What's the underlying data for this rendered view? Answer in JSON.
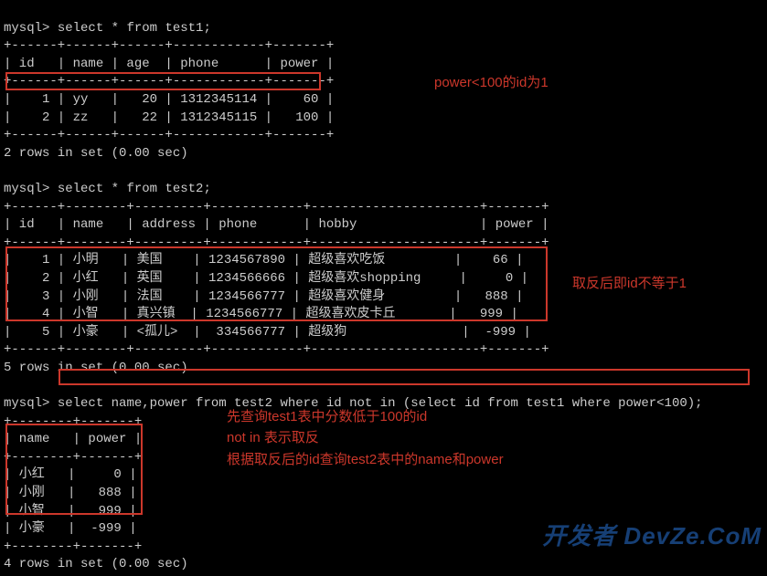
{
  "prompt": "mysql>",
  "query1": "select * from test1;",
  "table1": {
    "border_top": "+------+------+------+------------+-------+",
    "header": "| id   | name | age  | phone      | power |",
    "border_mid": "+------+------+------+------------+-------+",
    "row1": "|    1 | yy   |   20 | 1312345114 |    60 |",
    "row2": "|    2 | zz   |   22 | 1312345115 |   100 |",
    "border_bot": "+------+------+------+------------+-------+",
    "summary": "2 rows in set (0.00 sec)"
  },
  "query2": "select * from test2;",
  "table2": {
    "border_top": "+------+--------+---------+------------+----------------------+-------+",
    "header": "| id   | name   | address | phone      | hobby                | power |",
    "border_mid": "+------+--------+---------+------------+----------------------+-------+",
    "row1": "|    1 | 小明   | 美国    | 1234567890 | 超级喜欢吃饭         |    66 |",
    "row2": "|    2 | 小红   | 英国    | 1234566666 | 超级喜欢shopping     |     0 |",
    "row3": "|    3 | 小刚   | 法国    | 1234566777 | 超级喜欢健身         |   888 |",
    "row4": "|    4 | 小智   | 真兴镇  | 1234566777 | 超级喜欢皮卡丘       |   999 |",
    "row5": "|    5 | 小豪   | <孤儿>  |  334566777 | 超级狗               |  -999 |",
    "border_bot": "+------+--------+---------+------------+----------------------+-------+",
    "summary": "5 rows in set (0.00 sec)"
  },
  "query3": "select name,power from test2 where id not in (select id from test1 where power<100);",
  "table3": {
    "border_top": "+--------+-------+",
    "header": "| name   | power |",
    "border_mid": "+--------+-------+",
    "row1": "| 小红   |     0 |",
    "row2": "| 小刚   |   888 |",
    "row3": "| 小智   |   999 |",
    "row4": "| 小豪   |  -999 |",
    "border_bot": "+--------+-------+",
    "summary": "4 rows in set (0.00 sec)"
  },
  "annotations": {
    "a1": "power<100的id为1",
    "a2": "取反后即id不等于1",
    "a3_l1": "先查询test1表中分数低于100的id",
    "a3_l2": "not in 表示取反",
    "a3_l3": "根据取反后的id查询test2表中的name和power"
  },
  "watermark": "开发者\nDevZe.CoM"
}
